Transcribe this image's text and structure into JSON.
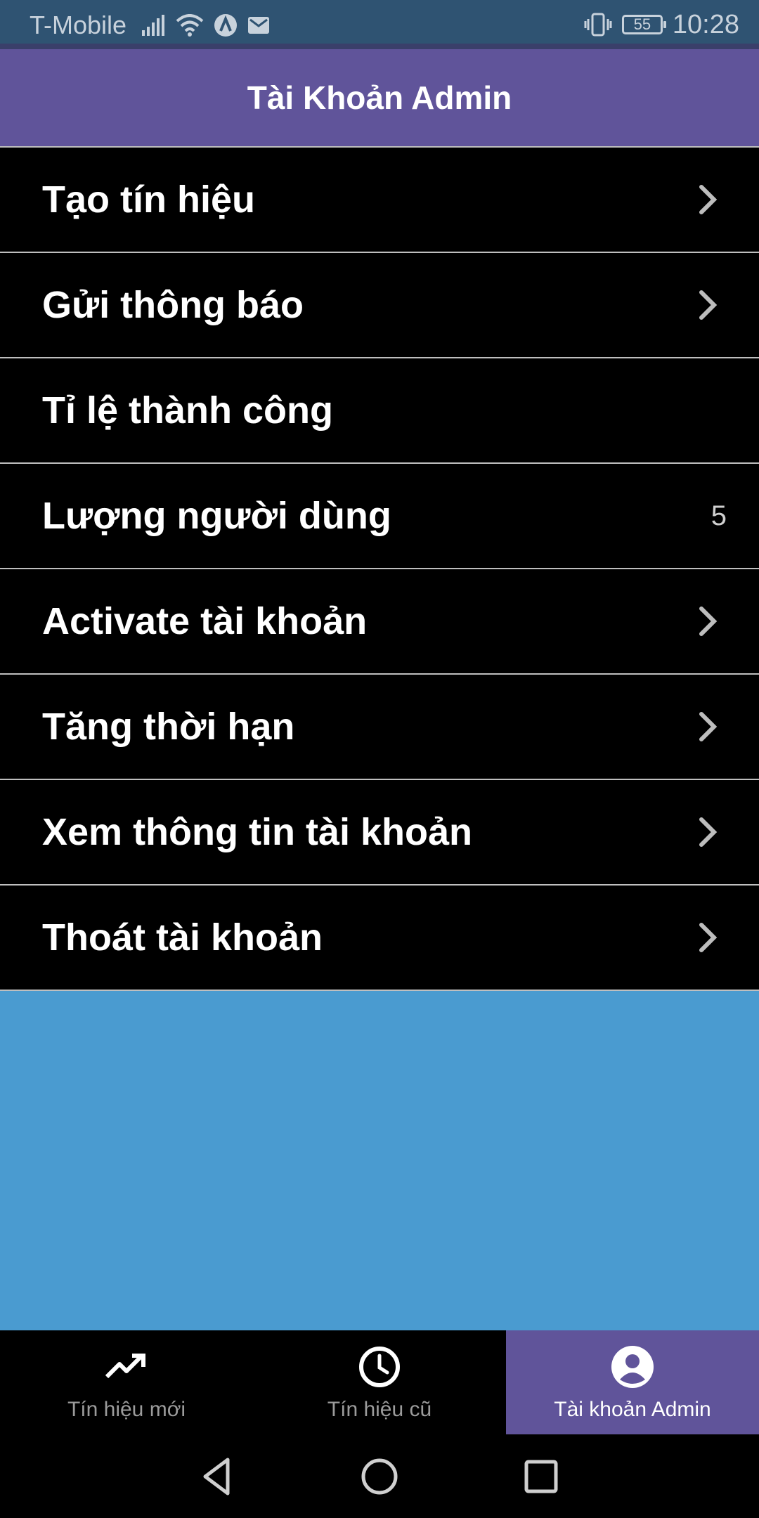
{
  "status_bar": {
    "carrier": "T-Mobile",
    "battery": "55",
    "time": "10:28",
    "icons": [
      "signal-icon",
      "wifi-icon",
      "app-a-icon",
      "mail-icon",
      "vibrate-icon",
      "battery-icon"
    ]
  },
  "header": {
    "title": "Tài Khoản Admin"
  },
  "menu": {
    "items": [
      {
        "label": "Tạo tín hiệu",
        "icon": "chevron-right-icon"
      },
      {
        "label": "Gửi thông báo",
        "icon": "chevron-right-icon"
      },
      {
        "label": "Tỉ lệ thành công"
      },
      {
        "label": "Lượng người dùng",
        "value": "5"
      },
      {
        "label": "Activate tài khoản",
        "icon": "chevron-right-icon"
      },
      {
        "label": "Tăng thời hạn",
        "icon": "chevron-right-icon"
      },
      {
        "label": "Xem thông tin tài khoản",
        "icon": "chevron-right-icon"
      },
      {
        "label": "Thoát tài khoản",
        "icon": "chevron-right-icon"
      }
    ]
  },
  "tabs": [
    {
      "label": "Tín hiệu mới",
      "icon": "trending-up-icon",
      "active": false
    },
    {
      "label": "Tín hiệu cũ",
      "icon": "clock-icon",
      "active": false
    },
    {
      "label": "Tài khoản Admin",
      "icon": "account-circle-icon",
      "active": true
    }
  ],
  "nav_bar": {
    "buttons": [
      "back-icon",
      "home-icon",
      "recents-icon"
    ]
  },
  "colors": {
    "header": "#60549a",
    "status_bar": "#2f5372",
    "content_background": "#4a9bd0",
    "menu_background": "#000000",
    "divider": "#bfbfbf"
  }
}
